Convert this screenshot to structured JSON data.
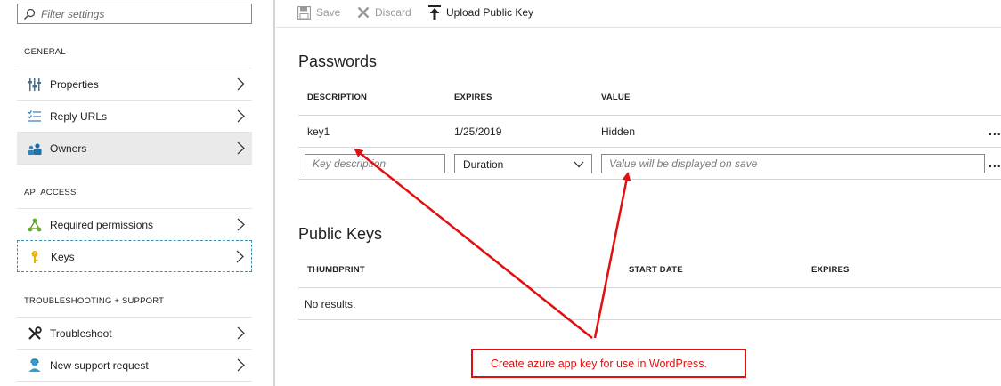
{
  "sidebar": {
    "filter_placeholder": "Filter settings",
    "sections": {
      "general": "GENERAL",
      "api_access": "API ACCESS",
      "troubleshooting": "TROUBLESHOOTING + SUPPORT"
    },
    "items": {
      "properties": "Properties",
      "reply_urls": "Reply URLs",
      "owners": "Owners",
      "required_permissions": "Required permissions",
      "keys": "Keys",
      "troubleshoot": "Troubleshoot",
      "new_support_request": "New support request"
    }
  },
  "toolbar": {
    "save_label": "Save",
    "discard_label": "Discard",
    "upload_label": "Upload Public Key"
  },
  "passwords": {
    "title": "Passwords",
    "columns": [
      "DESCRIPTION",
      "EXPIRES",
      "VALUE"
    ],
    "rows": [
      {
        "description": "key1",
        "expires": "1/25/2019",
        "value": "Hidden"
      }
    ],
    "new_row": {
      "description_placeholder": "Key description",
      "duration_selected": "Duration",
      "value_placeholder": "Value will be displayed on save"
    },
    "more_label": "..."
  },
  "public_keys": {
    "title": "Public Keys",
    "columns": [
      "THUMBPRINT",
      "START DATE",
      "EXPIRES"
    ],
    "empty_text": "No results."
  },
  "annotation": {
    "text": "Create azure app key for use in WordPress.",
    "color": "#e01010"
  }
}
